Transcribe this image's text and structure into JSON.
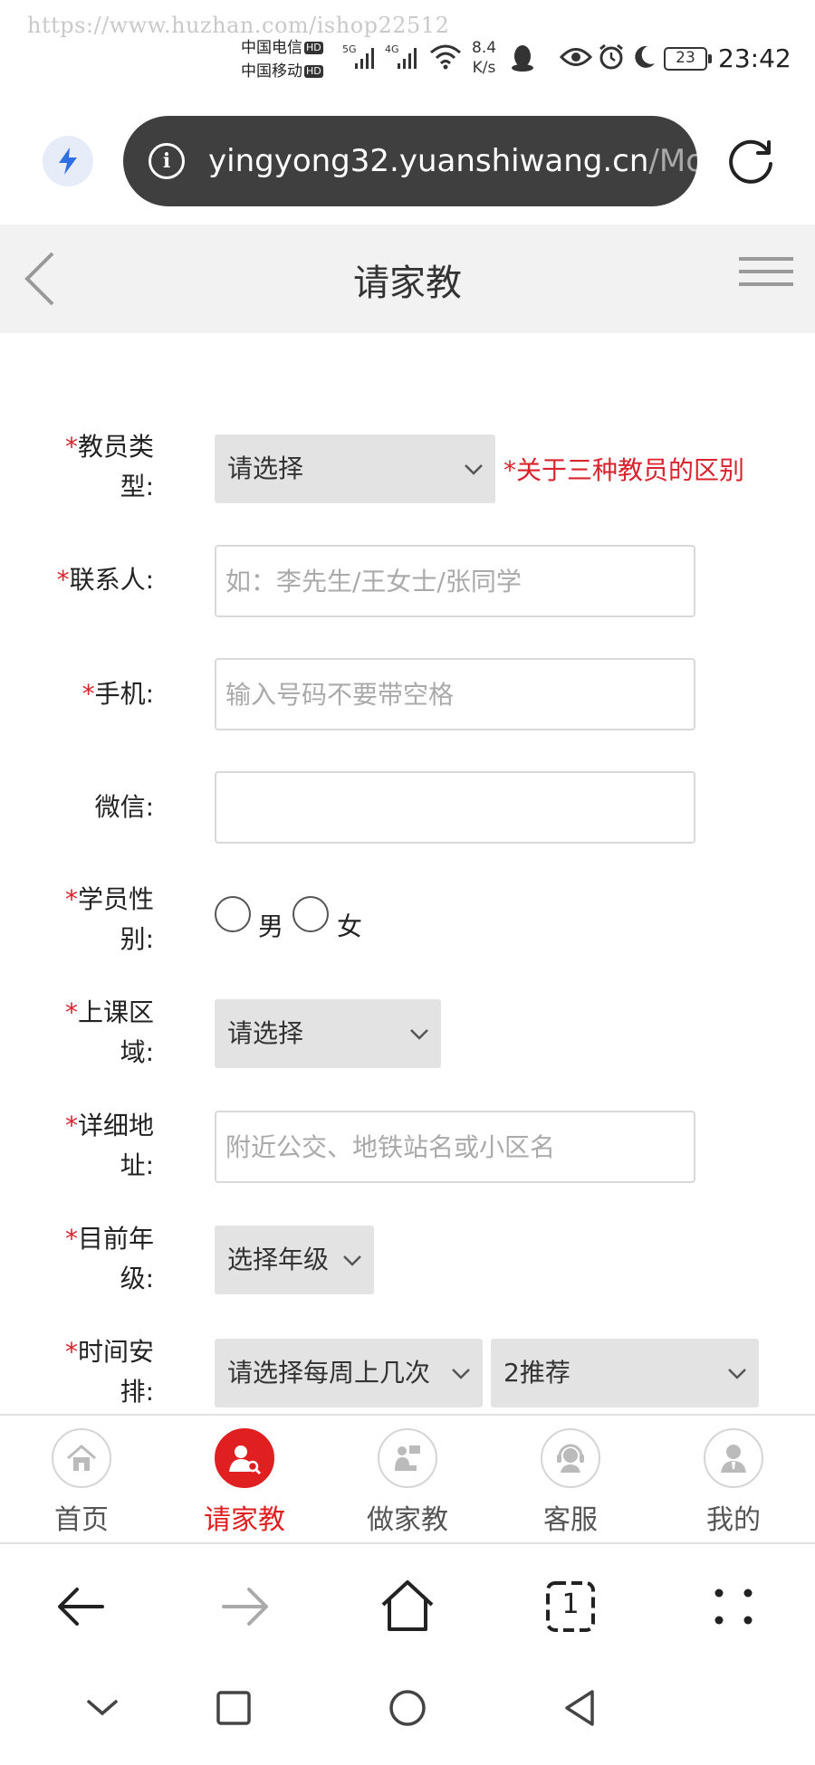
{
  "watermark": "https://www.huzhan.com/ishop22512",
  "status_bar": {
    "carrier_1": "中国电信",
    "carrier_2": "中国移动",
    "hd_badge": "HD",
    "signal_1": "5G",
    "signal_2": "4G",
    "speed_value": "8.4",
    "speed_unit": "K/s",
    "battery": "23",
    "time": "23:42"
  },
  "browser": {
    "url_main": "yingyong32.yuanshiwang.cn",
    "url_faded": "/Mobi"
  },
  "header": {
    "title": "请家教"
  },
  "form": {
    "teacher_type": {
      "label_line1": "教员类",
      "label_line2": "型:",
      "value": "请选择",
      "note": "*关于三种教员的区别"
    },
    "contact": {
      "label": "联系人:",
      "placeholder": "如：李先生/王女士/张同学"
    },
    "phone": {
      "label": "手机:",
      "placeholder": "输入号码不要带空格"
    },
    "wechat": {
      "label": "微信:",
      "placeholder": ""
    },
    "gender": {
      "label_line1": "学员性",
      "label_line2": "别:",
      "options": [
        "男",
        "女"
      ]
    },
    "district": {
      "label_line1": "上课区",
      "label_line2": "域:",
      "value": "请选择"
    },
    "address": {
      "label_line1": "详细地",
      "label_line2": "址:",
      "placeholder": "附近公交、地铁站名或小区名"
    },
    "grade": {
      "label_line1": "目前年",
      "label_line2": "级:",
      "value": "选择年级"
    },
    "schedule": {
      "label_line1": "时间安",
      "label_line2": "排:",
      "value_times": "请选择每周上几次",
      "value_recommend": "2推荐"
    },
    "required_mark": "*"
  },
  "tabs": [
    {
      "label": "首页",
      "icon": "home-icon",
      "active": false
    },
    {
      "label": "请家教",
      "icon": "find-tutor-icon",
      "active": true
    },
    {
      "label": "做家教",
      "icon": "be-tutor-icon",
      "active": false
    },
    {
      "label": "客服",
      "icon": "customer-service-icon",
      "active": false
    },
    {
      "label": "我的",
      "icon": "profile-icon",
      "active": false
    }
  ],
  "browser_nav": {
    "tab_count": "1"
  },
  "colors": {
    "accent": "#e02020",
    "url_bar": "#3f3f3f",
    "header_bg": "#f2f2f2",
    "select_bg": "#e3e3e3"
  }
}
